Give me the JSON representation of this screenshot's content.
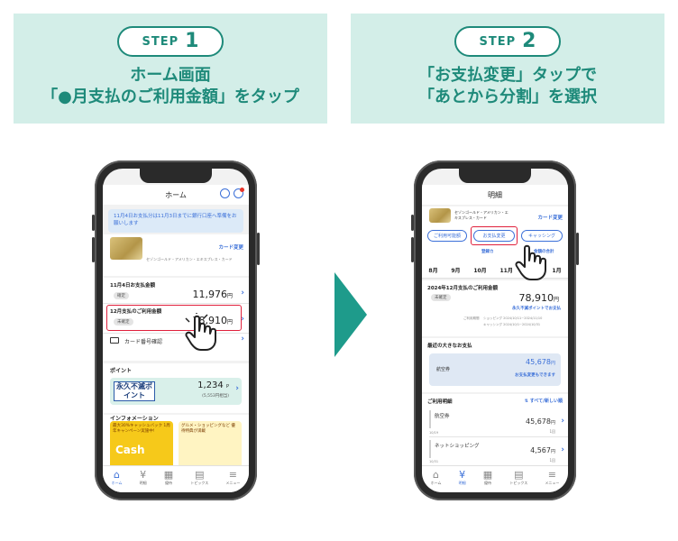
{
  "steps": [
    {
      "word": "STEP",
      "num": "1",
      "line1": "ホーム画面",
      "line2": "「●月支払のご利用金額」をタップ"
    },
    {
      "word": "STEP",
      "num": "2",
      "line1": "「お支払変更」タップで",
      "line2": "「あとから分割」を選択"
    }
  ],
  "phone1": {
    "header_title": "ホーム",
    "notice": "11月4日お支払分は11月3日までに銀行口座へ準備をお願いします",
    "card_link": "カード変更",
    "card_name": "セゾンゴールド・アメリカン・エキスプレス・カード",
    "row1_label": "11月4日お支払金額",
    "row1_tag": "確定",
    "row1_amount": "11,976",
    "row1_unit": "円",
    "row2_label": "12月支払のご利用金額",
    "row2_tag": "未確定",
    "row2_amount": "78,910",
    "row2_unit": "円",
    "card_number": "カード番号確認",
    "points_title": "ポイント",
    "points_logo": "永久不滅ポイント",
    "points_value": "1,234",
    "points_unit": "P",
    "points_sub": "(5,553円相当)",
    "info_title": "インフォメーション",
    "tile1_text": "最大30%キャッシュバック 1周年キャンペーン実施中!",
    "tile1_big": "Cash",
    "tile2_text": "グルメ・ショッピングなど 優待特典が満載",
    "tabs": [
      {
        "label": "ホーム",
        "icon": "⌂"
      },
      {
        "label": "明細",
        "icon": "¥"
      },
      {
        "label": "優待",
        "icon": "▦"
      },
      {
        "label": "トピックス",
        "icon": "▤"
      },
      {
        "label": "メニュー",
        "icon": "≡"
      }
    ]
  },
  "phone2": {
    "header_title": "明細",
    "card_name": "セゾンゴールド・アメリカン・エキスプレス・カード",
    "card_link": "カード変更",
    "btn1": "ご利用可能額",
    "btn2": "お支払変更",
    "btn3": "キャッシング",
    "sub_link1": "登録カ",
    "sub_link2": "金額の合計",
    "months": [
      "8月",
      "9月",
      "10月",
      "11月",
      "",
      "1月"
    ],
    "summary_title": "2024年12月支払のご利用金額",
    "summary_tag": "未確定",
    "summary_amount": "78,910",
    "summary_unit": "円",
    "summary_link": "永久不滅ポイントでお支払",
    "period_label": "ご利用期間",
    "period1": "ショッピング 2024/10/11~2024/11/10",
    "period2": "キャッシング 2024/10/1~2024/10/31",
    "recent_title": "最近の大きなお支払",
    "recent_item": "航空券",
    "recent_amount": "45,678",
    "recent_unit": "円",
    "recent_link": "お支払変更もできます",
    "list_title": "ご利用明細",
    "list_sort": "すべて/新しい順",
    "items": [
      {
        "name": "航空券",
        "date": "10/19",
        "amount": "45,678",
        "unit": "円",
        "count": "1回"
      },
      {
        "name": "ネットショッピング",
        "date": "10/31",
        "amount": "4,567",
        "unit": "円",
        "count": "1回"
      }
    ],
    "tabs": [
      {
        "label": "ホーム",
        "icon": "⌂"
      },
      {
        "label": "明細",
        "icon": "¥"
      },
      {
        "label": "優待",
        "icon": "▦"
      },
      {
        "label": "トピックス",
        "icon": "▤"
      },
      {
        "label": "メニュー",
        "icon": "≡"
      }
    ]
  }
}
